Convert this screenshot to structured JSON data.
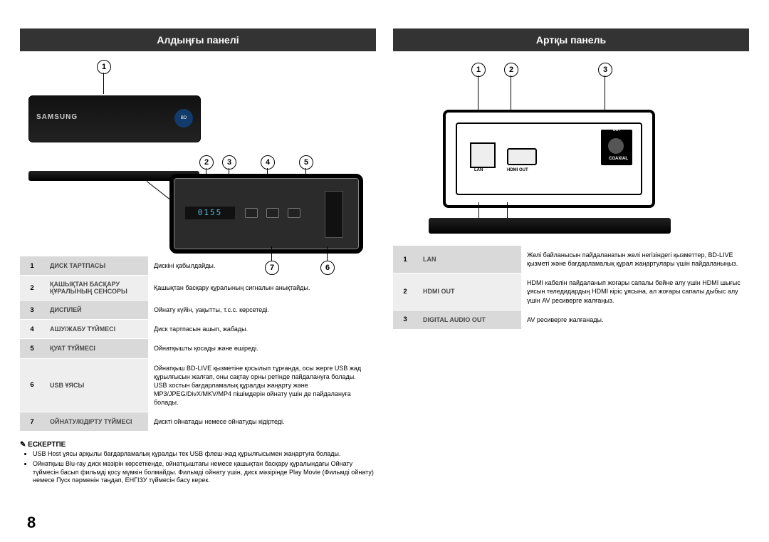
{
  "page_number": "8",
  "front": {
    "title": "Алдыңғы панелі",
    "brand": "SAMSUNG",
    "display_value": "0155",
    "callouts": [
      "1",
      "2",
      "3",
      "4",
      "5",
      "6",
      "7"
    ],
    "table": [
      {
        "n": "1",
        "label": "ДИСК ТАРТПАСЫ",
        "desc": "Дискіні қабылдайды."
      },
      {
        "n": "2",
        "label": "ҚАШЫҚТАН БАСҚАРУ ҚҰРАЛЫНЫҢ СЕНСОРЫ",
        "desc": "Қашықтан басқару құралының сигналын анықтайды."
      },
      {
        "n": "3",
        "label": "ДИСПЛЕЙ",
        "desc": "Ойнату күйін, уақытты, т.с.с. көрсетеді."
      },
      {
        "n": "4",
        "label": "АШУ/ЖАБУ ТҮЙМЕСІ",
        "desc": "Диск тартпасын ашып, жабады."
      },
      {
        "n": "5",
        "label": "ҚУАТ ТҮЙМЕСІ",
        "desc": "Ойнатқышты қосады және өшіреді."
      },
      {
        "n": "6",
        "label": "USB ҰЯСЫ",
        "desc": "Ойнатқыш BD-LIVE қызметіне қосылып тұрғанда, осы жерге USB жад құрылғысын жалғап, оны сақтау орны ретінде пайдалануға болады. USB хостын бағдарламалық құралды жаңарту және MP3/JPEG/DivX/MKV/MP4 пішімдерін ойнату үшін де пайдалануға болады."
      },
      {
        "n": "7",
        "label": "ОЙНАТУ/КІДІРТУ ТҮЙМЕСІ",
        "desc": "Дискті ойнатады немесе ойнатуды кідіртеді."
      }
    ],
    "note_title": "✎ ЕСКЕРТПЕ",
    "notes": [
      "USB Host ұясы арқылы бағдарламалық құралды тек USB флеш-жад құрылғысымен жаңартуға болады.",
      "Ойнатқыш Blu-ray диск мәзірін көрсеткенде, ойнатқыштағы немесе қашықтан басқару құралындағы Ойнату түймесін басып фильмді қосу мүмкін болмайды. Фильмді ойнату үшін, диск мәзірінде Play Movie (Фильмді ойнату) немесе Пуск пәрменін таңдап, ЕНГІЗУ түймесін басу керек."
    ]
  },
  "rear": {
    "title": "Артқы панель",
    "callouts": [
      "1",
      "2",
      "3"
    ],
    "port_labels": {
      "lan": "LAN",
      "hdmi": "HDMI OUT",
      "coax_box_top": "DIGITAL AUDIO OUT",
      "coax": "COAXIAL"
    },
    "table": [
      {
        "n": "1",
        "label": "LAN",
        "desc": "Желі байланысын пайдаланатын желі негізіндегі қызметтер, BD-LIVE қызметі және бағдарламалық құрал жаңартулары үшін пайдаланыңыз."
      },
      {
        "n": "2",
        "label": "HDMI OUT",
        "desc": "HDMI кабелін пайдаланып жоғары сапалы бейне алу үшін HDMI шығыс ұясын теледидардың HDMI кіріс ұясына, ал жоғары сапалы дыбыс алу үшін AV ресиверге жалғаңыз."
      },
      {
        "n": "3",
        "label": "DIGITAL AUDIO OUT",
        "desc": "AV ресиверге жалғанады."
      }
    ]
  }
}
